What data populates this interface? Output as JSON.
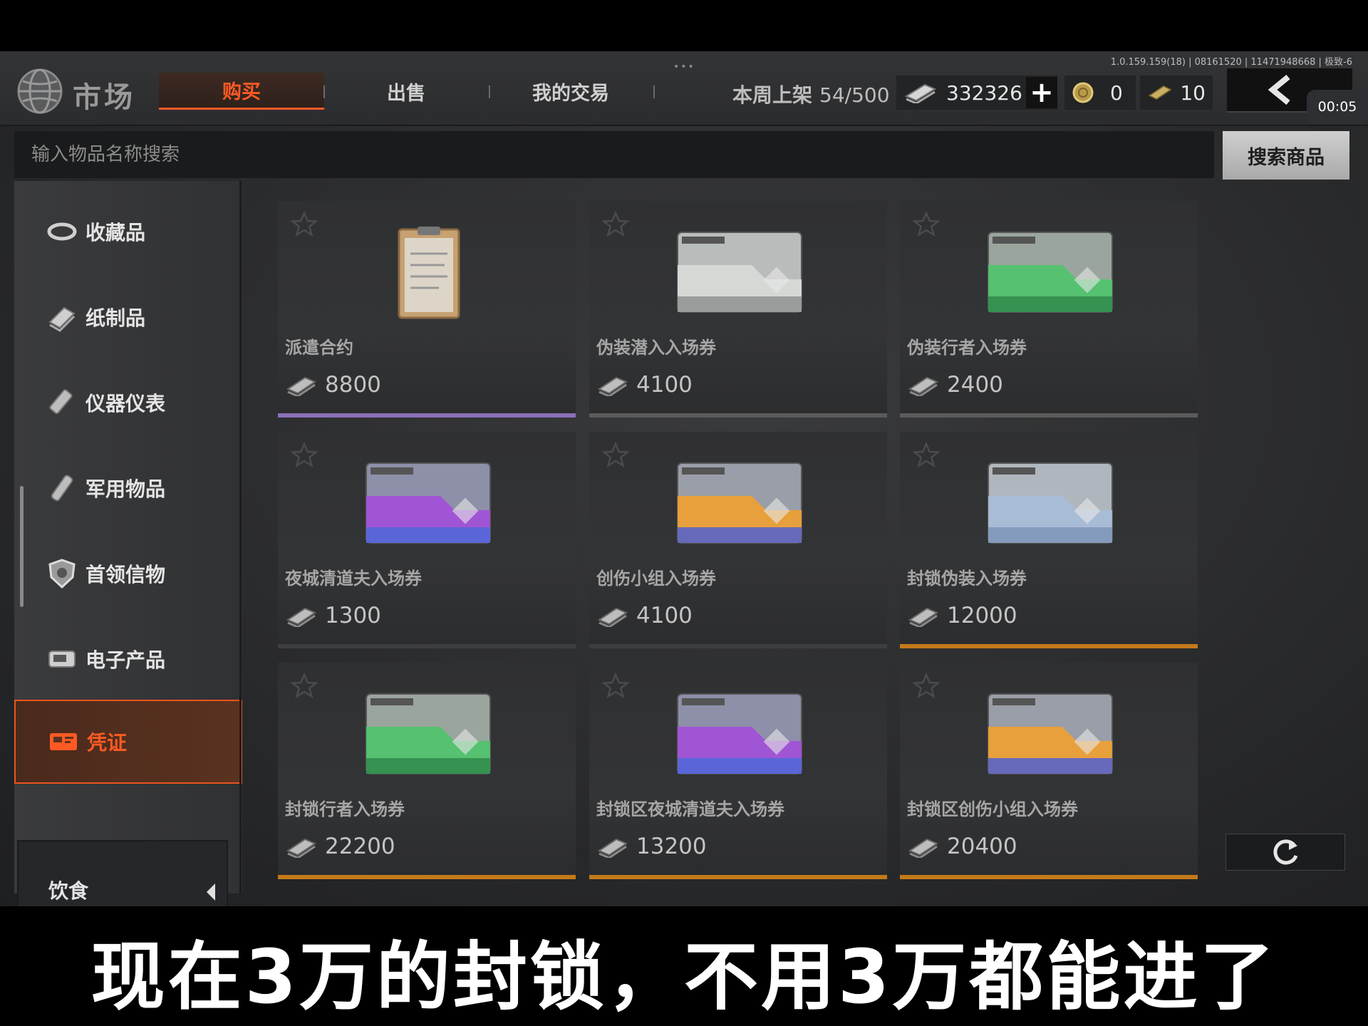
{
  "version": "1.0.159.159(18) | 08161520 | 11471948668 | 极致-6",
  "header": {
    "title": "市场",
    "tabs": [
      {
        "label": "购买",
        "active": true
      },
      {
        "label": "出售",
        "active": false
      },
      {
        "label": "我的交易",
        "active": false
      }
    ],
    "weekly_label": "本周上架",
    "weekly_value": "54/500",
    "currencies": {
      "cash": "332326",
      "coin": "0",
      "ticket": "10"
    },
    "timer": "00:05"
  },
  "search": {
    "placeholder": "输入物品名称搜索",
    "button_label": "搜索商品"
  },
  "sidebar": {
    "items": [
      {
        "label": "收藏品",
        "icon": "collectible-ring-icon"
      },
      {
        "label": "纸制品",
        "icon": "paper-book-icon"
      },
      {
        "label": "仪器仪表",
        "icon": "instrument-device-icon"
      },
      {
        "label": "军用物品",
        "icon": "military-flashlight-icon"
      },
      {
        "label": "首领信物",
        "icon": "boss-badge-icon"
      },
      {
        "label": "电子产品",
        "icon": "electronics-icon"
      },
      {
        "label": "凭证",
        "icon": "voucher-card-icon",
        "active": true
      },
      {
        "label": "饮食",
        "icon": "chevron-left-icon"
      }
    ]
  },
  "items": [
    {
      "name": "派遣合约",
      "price": "8800",
      "kind": "clipboard",
      "color": "#8a6fb8"
    },
    {
      "name": "伪装潜入入场券",
      "price": "4100",
      "kind": "card-gray",
      "color": "#5b5b5b"
    },
    {
      "name": "伪装行者入场券",
      "price": "2400",
      "kind": "card-green",
      "color": "#5b5b5b"
    },
    {
      "name": "夜城清道夫入场券",
      "price": "1300",
      "kind": "card-purple",
      "color": "#3d3e40"
    },
    {
      "name": "创伤小组入场券",
      "price": "4100",
      "kind": "card-orange",
      "color": "#3d3e40"
    },
    {
      "name": "封锁伪装入场券",
      "price": "12000",
      "kind": "card-blue",
      "color": "#c47a1a"
    },
    {
      "name": "封锁行者入场券",
      "price": "22200",
      "kind": "card-green",
      "color": "#c47a1a"
    },
    {
      "name": "封锁区夜城清道夫入场券",
      "price": "13200",
      "kind": "card-purple",
      "color": "#c47a1a"
    },
    {
      "name": "封锁区创伤小组入场券",
      "price": "20400",
      "kind": "card-orange",
      "color": "#c47a1a"
    }
  ],
  "accent_color": "#ff5a24",
  "subtitle": "现在3万的封锁，不用3万都能进了"
}
